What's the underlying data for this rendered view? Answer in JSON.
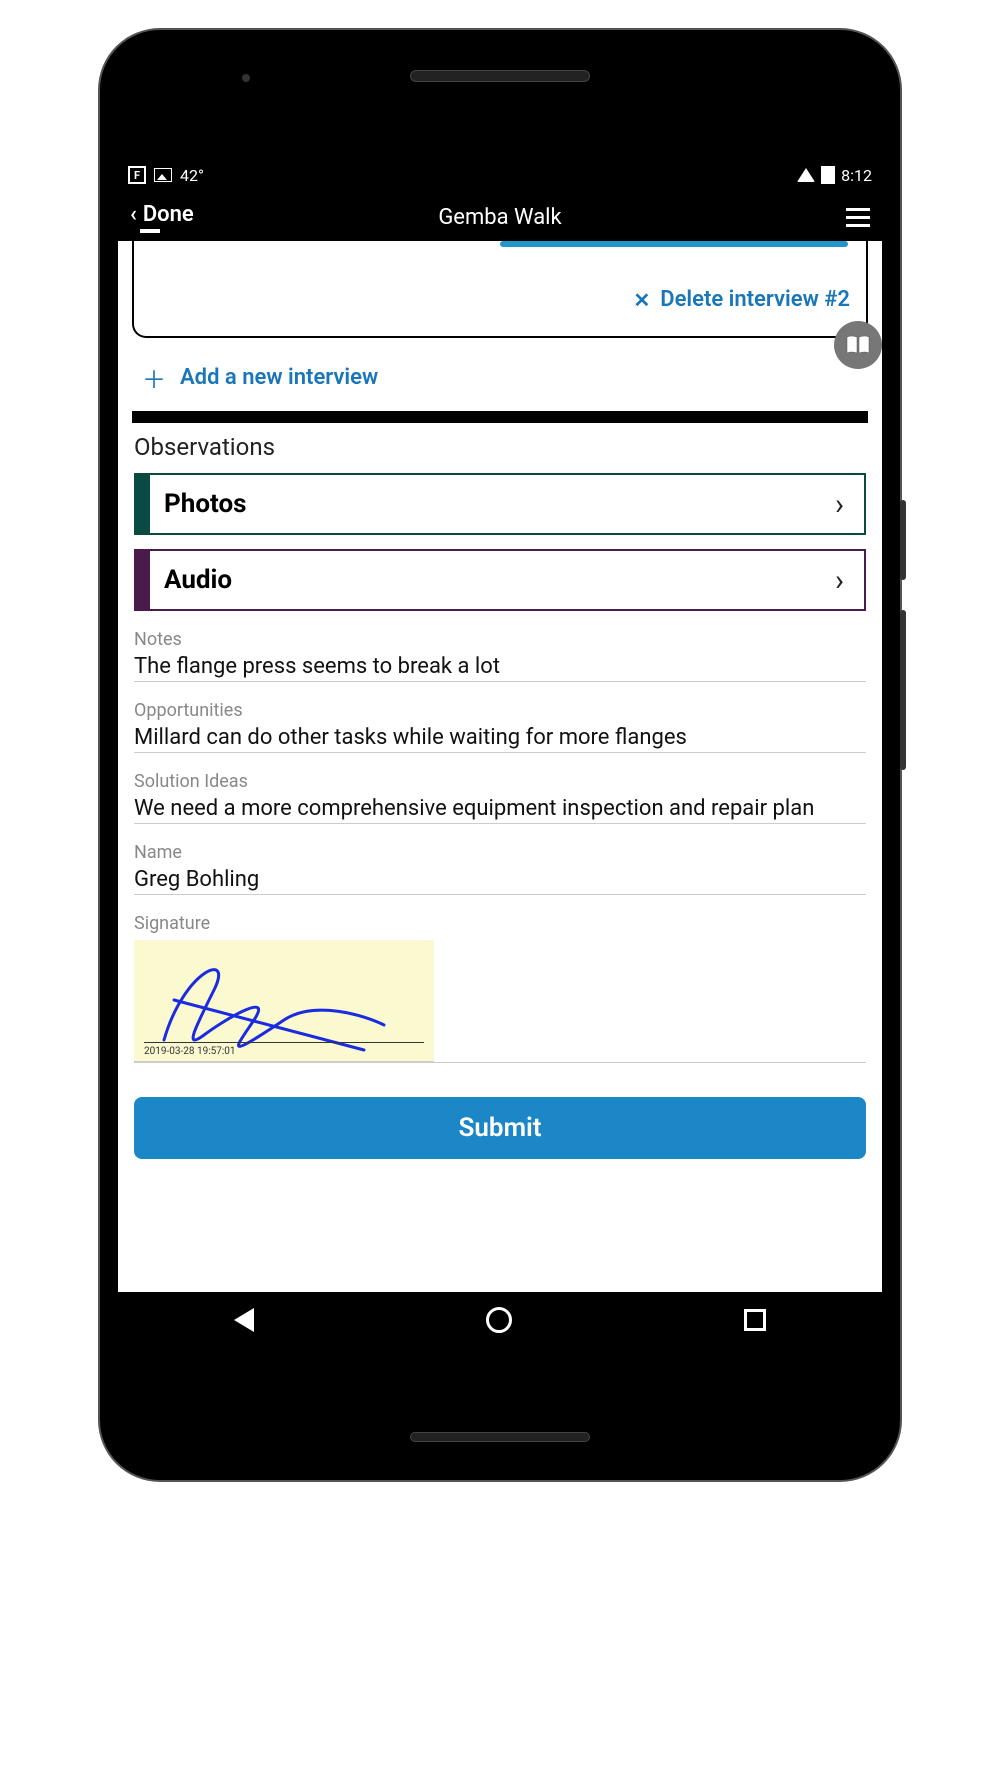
{
  "status": {
    "temperature": "42°",
    "time": "8:12"
  },
  "header": {
    "back_label": "Done",
    "title": "Gemba Walk"
  },
  "interview": {
    "delete_label": "Delete interview #2",
    "add_label": "Add a new interview"
  },
  "observations": {
    "title": "Observations",
    "photos_label": "Photos",
    "audio_label": "Audio"
  },
  "fields": {
    "notes_label": "Notes",
    "notes_value": "The flange press seems to break a lot",
    "opportunities_label": "Opportunities",
    "opportunities_value": "Millard can do other tasks while waiting for more flanges",
    "solution_label": "Solution Ideas",
    "solution_value": "We need a more comprehensive equipment inspection and repair plan",
    "name_label": "Name",
    "name_value": "Greg Bohling",
    "signature_label": "Signature",
    "signature_date": "2019-03-28 19:57:01"
  },
  "submit_label": "Submit"
}
